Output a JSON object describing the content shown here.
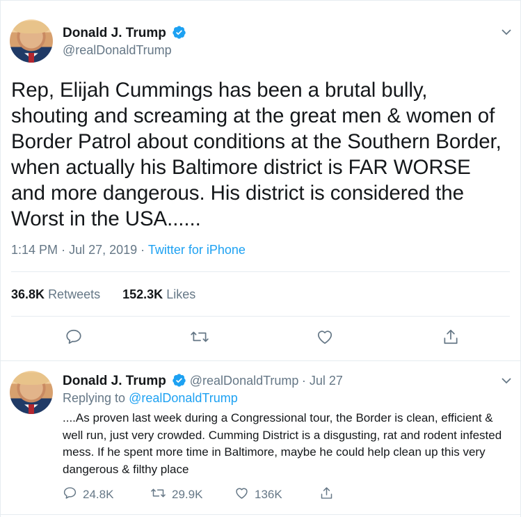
{
  "tweet": {
    "author_name": "Donald J. Trump",
    "author_handle": "@realDonaldTrump",
    "text": "Rep, Elijah Cummings has been a brutal bully, shouting and screaming at the great men & women of Border Patrol about conditions at the Southern Border, when actually his Baltimore district is FAR WORSE and more dangerous. His district is considered the Worst in the USA......",
    "time": "1:14 PM",
    "date": "Jul 27, 2019",
    "source": "Twitter for iPhone",
    "retweets_count": "36.8K",
    "retweets_label": "Retweets",
    "likes_count": "152.3K",
    "likes_label": "Likes",
    "icons": [
      "reply-icon",
      "retweet-icon",
      "like-icon",
      "share-icon",
      "caret-down-icon",
      "verified-icon"
    ]
  },
  "reply_tweet": {
    "author_name": "Donald J. Trump",
    "author_handle": "@realDonaldTrump",
    "date": "Jul 27",
    "replying_prefix": "Replying to",
    "replying_to": "@realDonaldTrump",
    "text": "....As proven last week during a Congressional tour, the Border is clean, efficient & well run, just very crowded. Cumming District is a disgusting, rat and rodent infested mess. If he spent more time in Baltimore, maybe he could help clean up this very dangerous & filthy place",
    "reply_count": "24.8K",
    "retweet_count": "29.9K",
    "like_count": "136K"
  },
  "colors": {
    "text": "#14171a",
    "secondary": "#657786",
    "link": "#1da1f2",
    "border": "#e6ecf0"
  }
}
